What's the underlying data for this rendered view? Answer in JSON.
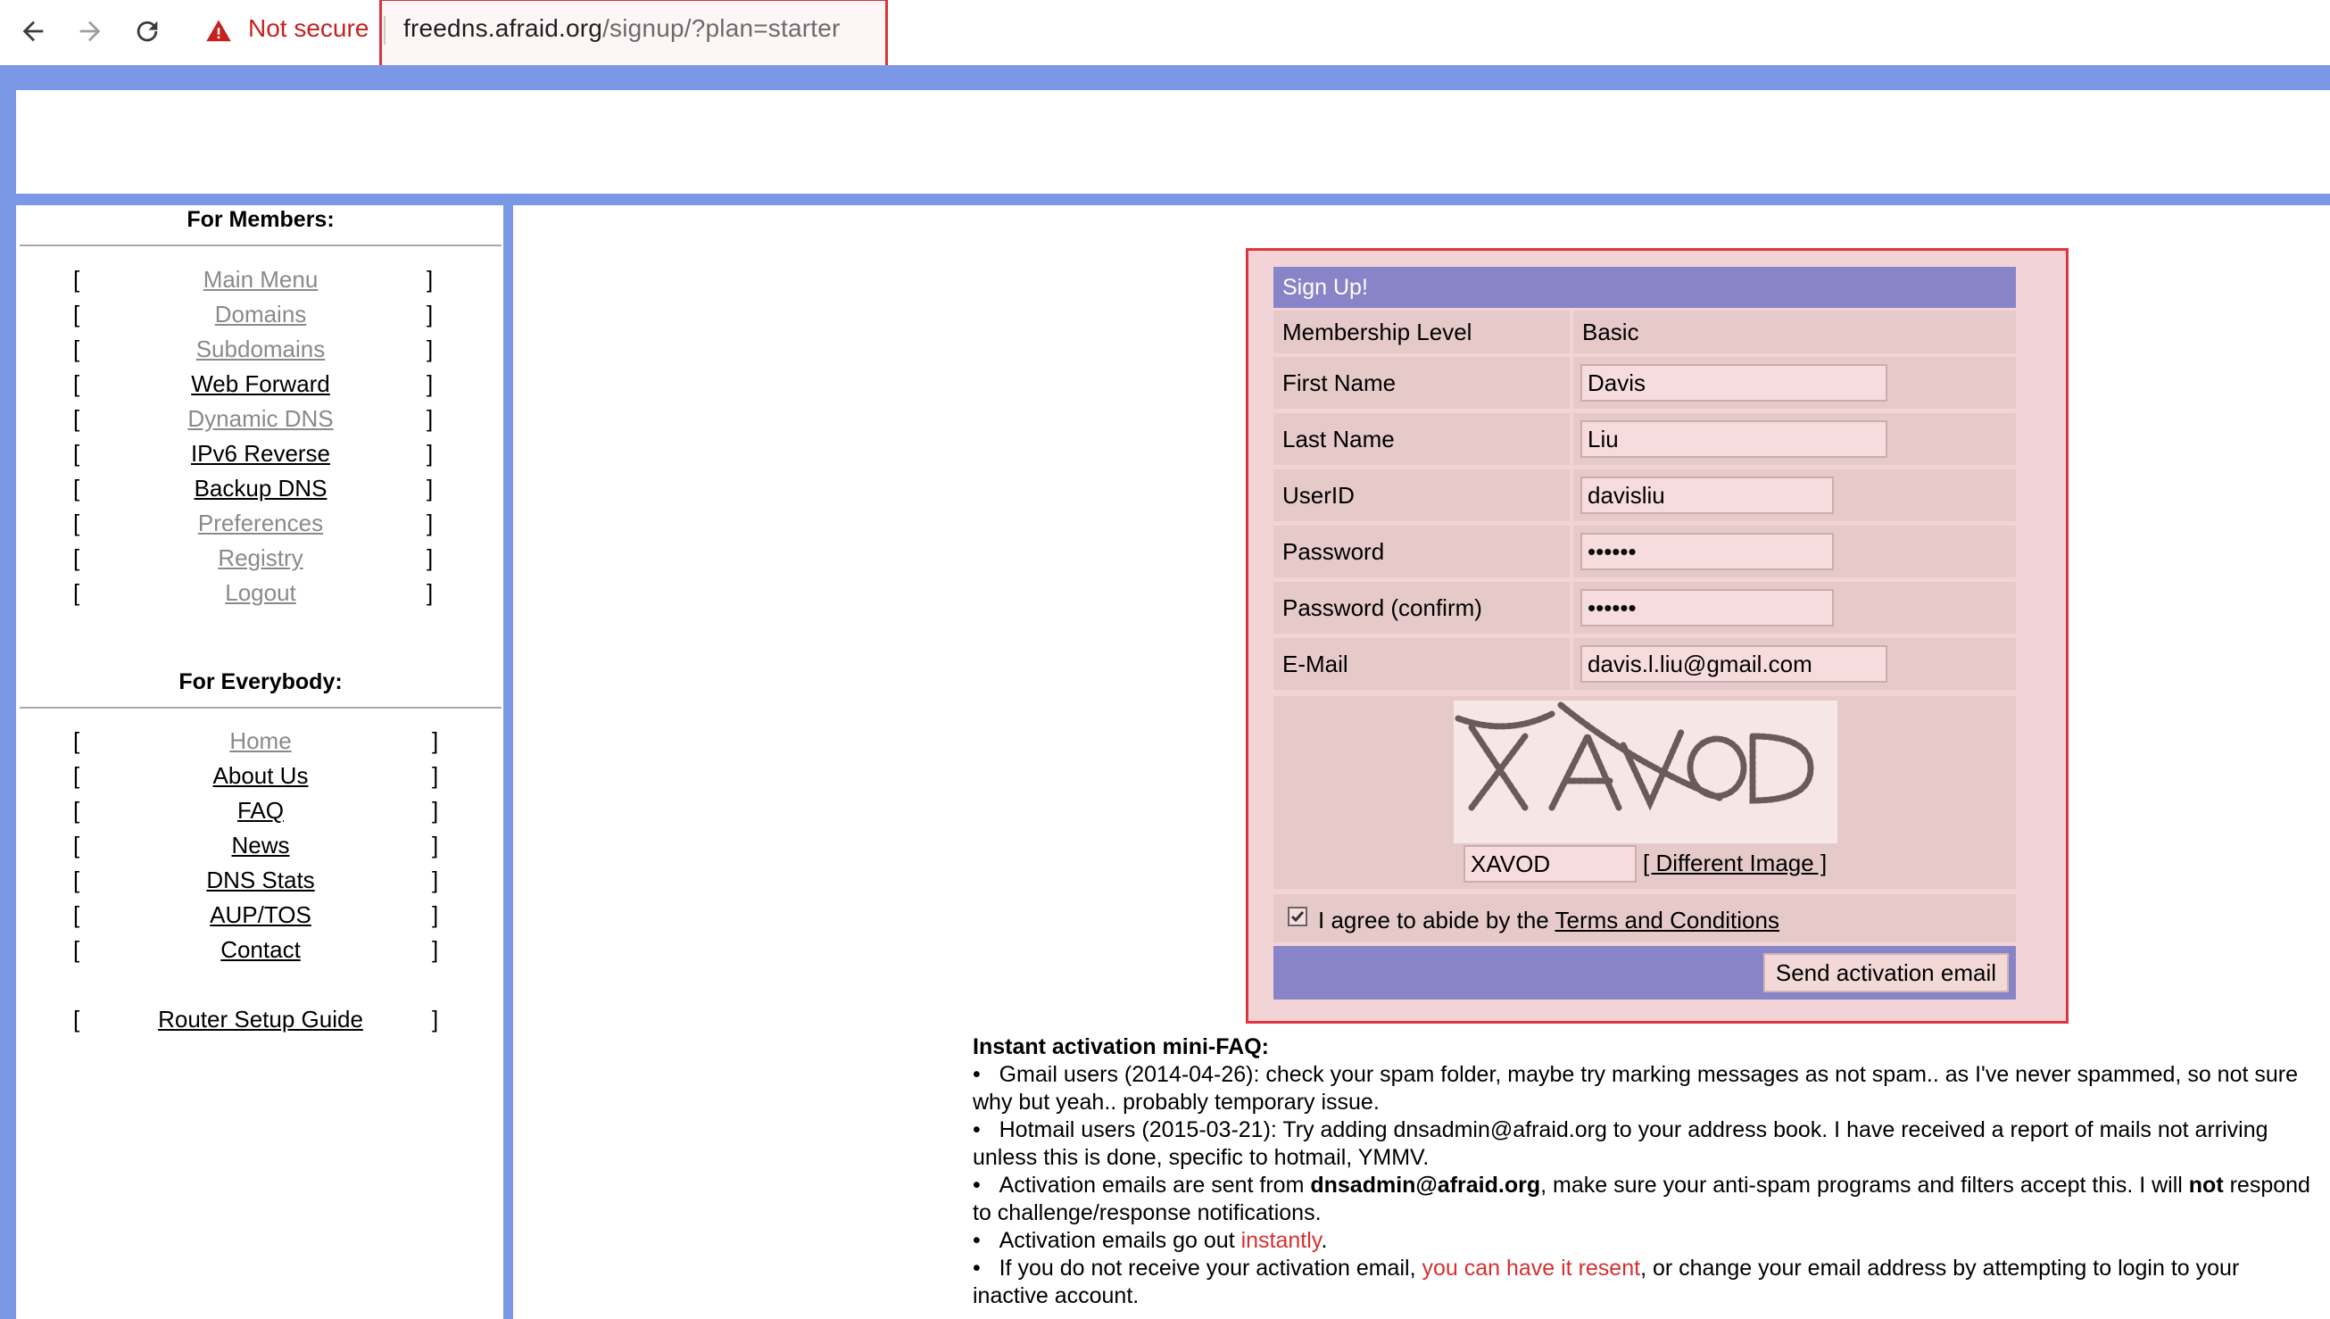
{
  "browser": {
    "security_label": "Not secure",
    "url_host": "freedns.afraid.org",
    "url_path": "/signup/?plan=starter",
    "icons": [
      "back-arrow-icon",
      "forward-arrow-icon",
      "reload-icon",
      "warning-triangle-icon"
    ],
    "warning_color": "#c5221f"
  },
  "sidebar": {
    "members_heading": "For Members:",
    "members": [
      {
        "label": "Main Menu",
        "style": "visited"
      },
      {
        "label": "Domains",
        "style": "visited"
      },
      {
        "label": "Subdomains",
        "style": "visited"
      },
      {
        "label": "Web Forward",
        "style": "link"
      },
      {
        "label": "Dynamic DNS",
        "style": "visited"
      },
      {
        "label": "IPv6 Reverse",
        "style": "link"
      },
      {
        "label": "Backup DNS",
        "style": "link"
      },
      {
        "label": "Preferences",
        "style": "visited"
      },
      {
        "label": "Registry",
        "style": "visited"
      },
      {
        "label": "Logout",
        "style": "visited"
      }
    ],
    "everybody_heading": "For Everybody:",
    "everybody": [
      {
        "label": "Home",
        "style": "visited"
      },
      {
        "label": "About Us",
        "style": "link"
      },
      {
        "label": "FAQ",
        "style": "link"
      },
      {
        "label": "News",
        "style": "link"
      },
      {
        "label": "DNS Stats",
        "style": "link"
      },
      {
        "label": "AUP/TOS",
        "style": "link"
      },
      {
        "label": "Contact",
        "style": "link"
      }
    ],
    "router_guide": "Router Setup Guide",
    "bracket_open": "[",
    "bracket_close": "]"
  },
  "signup": {
    "title": "Sign Up!",
    "membership_label": "Membership Level",
    "membership_value": "Basic",
    "first_name_label": "First Name",
    "first_name_value": "Davis",
    "last_name_label": "Last Name",
    "last_name_value": "Liu",
    "userid_label": "UserID",
    "userid_value": "davisliu",
    "password_label": "Password",
    "password_value": "••••••",
    "password_confirm_label": "Password (confirm)",
    "password_confirm_value": "••••••",
    "email_label": "E-Mail",
    "email_value": "davis.l.liu@gmail.com",
    "captcha_value": "XAVOD",
    "different_image_link": "[ Different Image ]",
    "agree_checked": true,
    "agree_prefix": "I agree to abide by the ",
    "agree_link": "Terms and Conditions",
    "submit_label": "Send activation email",
    "colors": {
      "header": "#8784c8",
      "cell": "#e6caca",
      "outline": "#e0353f"
    }
  },
  "faq": {
    "title": "Instant activation mini-FAQ:",
    "bullet": "•",
    "item1": "Gmail users (2014-04-26): check your spam folder, maybe try marking messages as not spam.. as I've never spammed, so not sure why but yeah.. probably temporary issue.",
    "item2": "Hotmail users (2015-03-21): Try adding dnsadmin@afraid.org to your address book. I have received a report of mails not arriving unless this is done, specific to hotmail, YMMV.",
    "item3_a": "Activation emails are sent from ",
    "item3_b": "dnsadmin@afraid.org",
    "item3_c": ", make sure your anti-spam programs and filters accept this. I will ",
    "item3_d": "not",
    "item3_e": " respond to challenge/response notifications.",
    "item4_a": "Activation emails go out ",
    "item4_b": "instantly",
    "item4_c": ".",
    "item5_a": "If you do not receive your activation email, ",
    "item5_b": "you can have it resent",
    "item5_c": ", or change your email address by attempting to login to your inactive account."
  }
}
